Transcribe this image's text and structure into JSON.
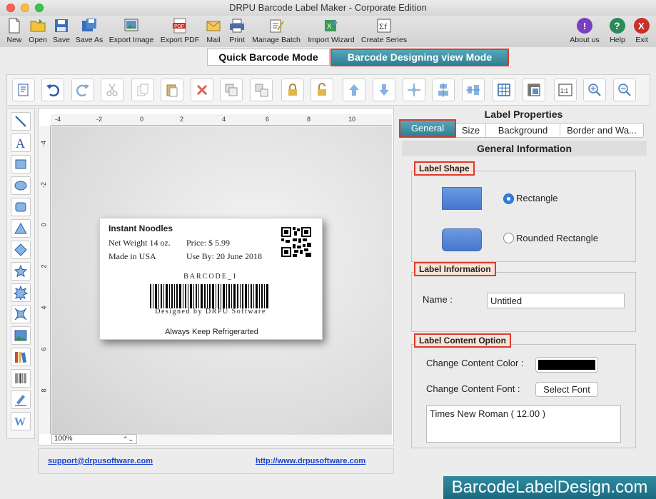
{
  "window": {
    "title": "DRPU Barcode Label Maker - Corporate Edition"
  },
  "toolbar": {
    "items": [
      {
        "label": "New",
        "icon": "new-file-icon"
      },
      {
        "label": "Open",
        "icon": "open-folder-icon"
      },
      {
        "label": "Save",
        "icon": "save-icon"
      },
      {
        "label": "Save As",
        "icon": "save-as-icon"
      },
      {
        "label": "Export Image",
        "icon": "export-image-icon"
      },
      {
        "label": "Export PDF",
        "icon": "export-pdf-icon"
      },
      {
        "label": "Mail",
        "icon": "mail-icon"
      },
      {
        "label": "Print",
        "icon": "print-icon"
      },
      {
        "label": "Manage Batch",
        "icon": "manage-batch-icon"
      },
      {
        "label": "Import Wizard",
        "icon": "import-wizard-icon"
      },
      {
        "label": "Create Series",
        "icon": "create-series-icon"
      }
    ],
    "right": [
      {
        "label": "About us",
        "icon": "about-icon",
        "color": "#7a3fc0"
      },
      {
        "label": "Help",
        "icon": "help-icon",
        "color": "#2a8a5a"
      },
      {
        "label": "Exit",
        "icon": "exit-icon",
        "color": "#c8302a"
      }
    ]
  },
  "modes": {
    "quick": "Quick Barcode Mode",
    "design": "Barcode Designing view Mode"
  },
  "canvas": {
    "zoom": "100%",
    "hruler": [
      "-4",
      "-2",
      "0",
      "2",
      "4",
      "6",
      "8",
      "10"
    ],
    "vruler": [
      "-4",
      "-2",
      "0",
      "2",
      "4",
      "6",
      "8"
    ]
  },
  "label": {
    "title": "Instant Noodles",
    "net_weight": "Net Weight 14 oz.",
    "price": "Price: $ 5.99",
    "made_in": "Made in USA",
    "use_by": "Use By: 20 June 2018",
    "barcode_header": "BARCODE_1",
    "barcode_footer": "Designed by DRPU Software",
    "footer": "Always Keep Refrigerarted"
  },
  "footer": {
    "support": "support@drpusoftware.com",
    "website": "http://www.drpusoftware.com"
  },
  "panel": {
    "title": "Label Properties",
    "tabs": [
      "General",
      "Size",
      "Background",
      "Border and Wa..."
    ],
    "section": "General Information",
    "label_shape": {
      "title": "Label Shape",
      "options": [
        "Rectangle",
        "Rounded Rectangle"
      ],
      "selected": "Rectangle"
    },
    "label_info": {
      "title": "Label Information",
      "name_label": "Name :",
      "name_value": "Untitled"
    },
    "content": {
      "title": "Label Content Option",
      "color_label": "Change Content Color :",
      "color_value": "#000000",
      "font_label": "Change Content Font :",
      "font_button": "Select Font",
      "font_value": "Times New Roman ( 12.00 )"
    }
  },
  "watermark": "BarcodeLabelDesign.com"
}
